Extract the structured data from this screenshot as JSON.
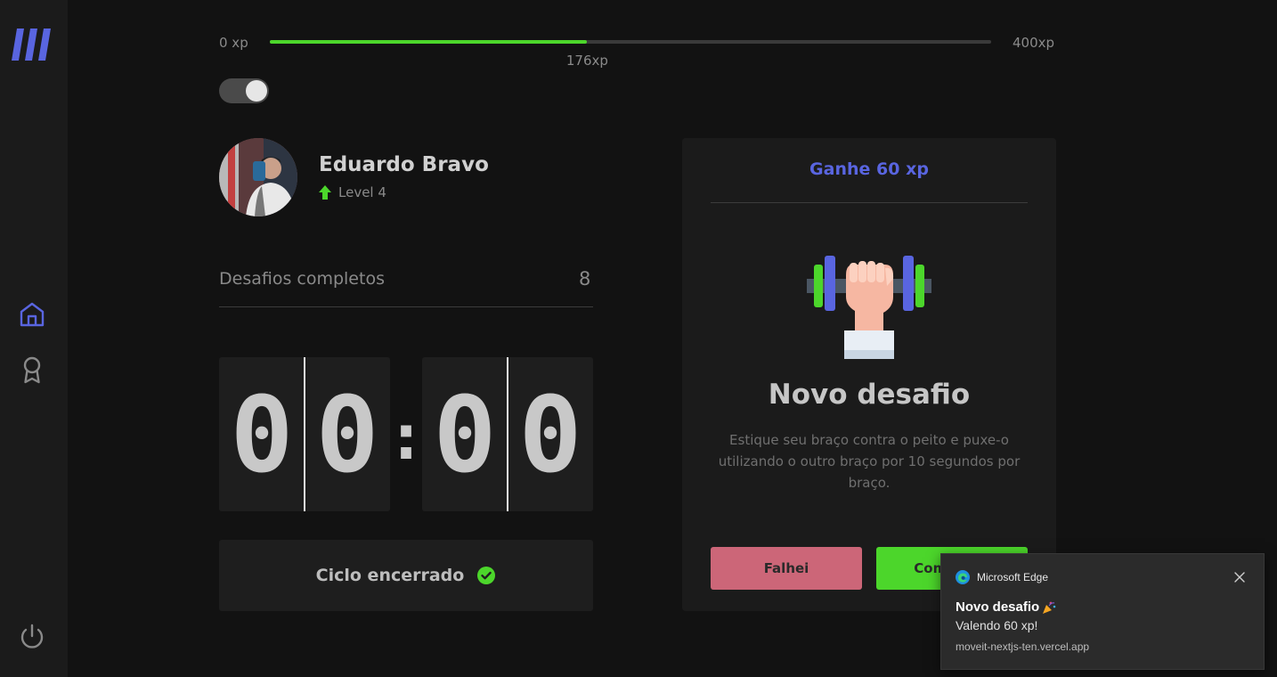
{
  "colors": {
    "accent": "#5965e0",
    "success": "#4cd62b",
    "fail": "#cc6678",
    "background": "#121212",
    "card": "#1b1b1b"
  },
  "sidebar": {
    "logo_icon": "moveit-logo-icon",
    "items": [
      {
        "icon": "home-icon",
        "active": true
      },
      {
        "icon": "award-icon",
        "active": false
      }
    ],
    "logout_icon": "power-icon"
  },
  "experience": {
    "min_label": "0 xp",
    "max_label": "400xp",
    "current_label": "176xp",
    "current": 176,
    "max": 400
  },
  "theme_toggle": {
    "on": true
  },
  "profile": {
    "name": "Eduardo Bravo",
    "level_label": "Level 4",
    "level_icon": "level-up-arrow-icon"
  },
  "completed_challenges": {
    "label": "Desafios completos",
    "count": "8"
  },
  "countdown": {
    "minute_left": "0",
    "minute_right": "0",
    "colon": ":",
    "second_left": "0",
    "second_right": "0"
  },
  "cycle_button": {
    "label": "Ciclo encerrado",
    "icon": "check-circle-icon"
  },
  "challenge": {
    "reward": "Ganhe 60 xp",
    "icon": "dumbbell-icon",
    "title": "Novo desafio",
    "description": "Estique seu braço contra o peito e puxe-o utilizando o outro braço por 10 segundos por braço.",
    "fail_label": "Falhei",
    "success_label": "Completei"
  },
  "notification": {
    "app_name": "Microsoft Edge",
    "title": "Novo desafio",
    "body": "Valendo 60 xp!",
    "source": "moveit-nextjs-ten.vercel.app"
  }
}
